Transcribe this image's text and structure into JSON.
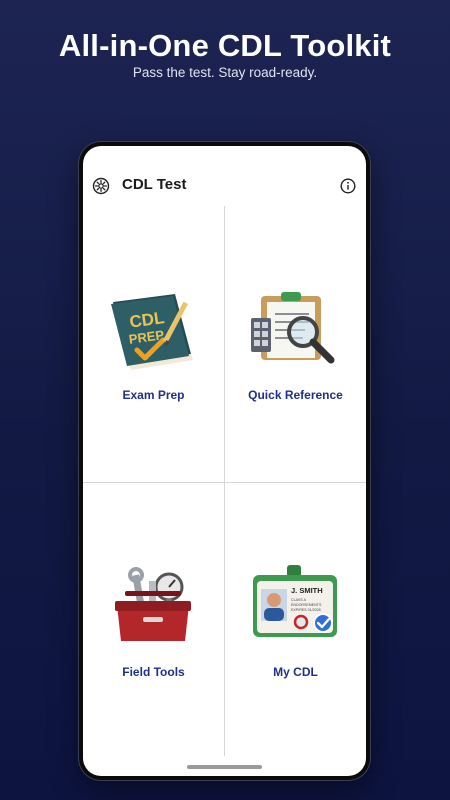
{
  "promo": {
    "headline": "All-in-One CDL Toolkit",
    "subhead": "Pass the test. Stay road-ready."
  },
  "app": {
    "title": "CDL Test",
    "settings_icon": "gear-icon",
    "info_icon": "info-icon"
  },
  "tiles": [
    {
      "label": "Exam Prep",
      "icon": "cdl-prep-book-icon",
      "book_line1": "CDL",
      "book_line2": "PREP"
    },
    {
      "label": "Quick Reference",
      "icon": "clipboard-magnifier-icon"
    },
    {
      "label": "Field Tools",
      "icon": "toolbox-icon"
    },
    {
      "label": "My CDL",
      "icon": "license-card-icon",
      "card_name": "J. SMITH",
      "card_class": "CLASS A",
      "card_line2": "ENDORSEMENTS",
      "card_line3": "EXPIRES 01/2028"
    }
  ],
  "colors": {
    "background": "#151c47",
    "accent_label": "#1f2f8c",
    "book": "#2f5f66",
    "book_text": "#e8c35a",
    "check": "#f0a020",
    "toolbox": "#b3262a",
    "badge": "#3e9a4f"
  }
}
